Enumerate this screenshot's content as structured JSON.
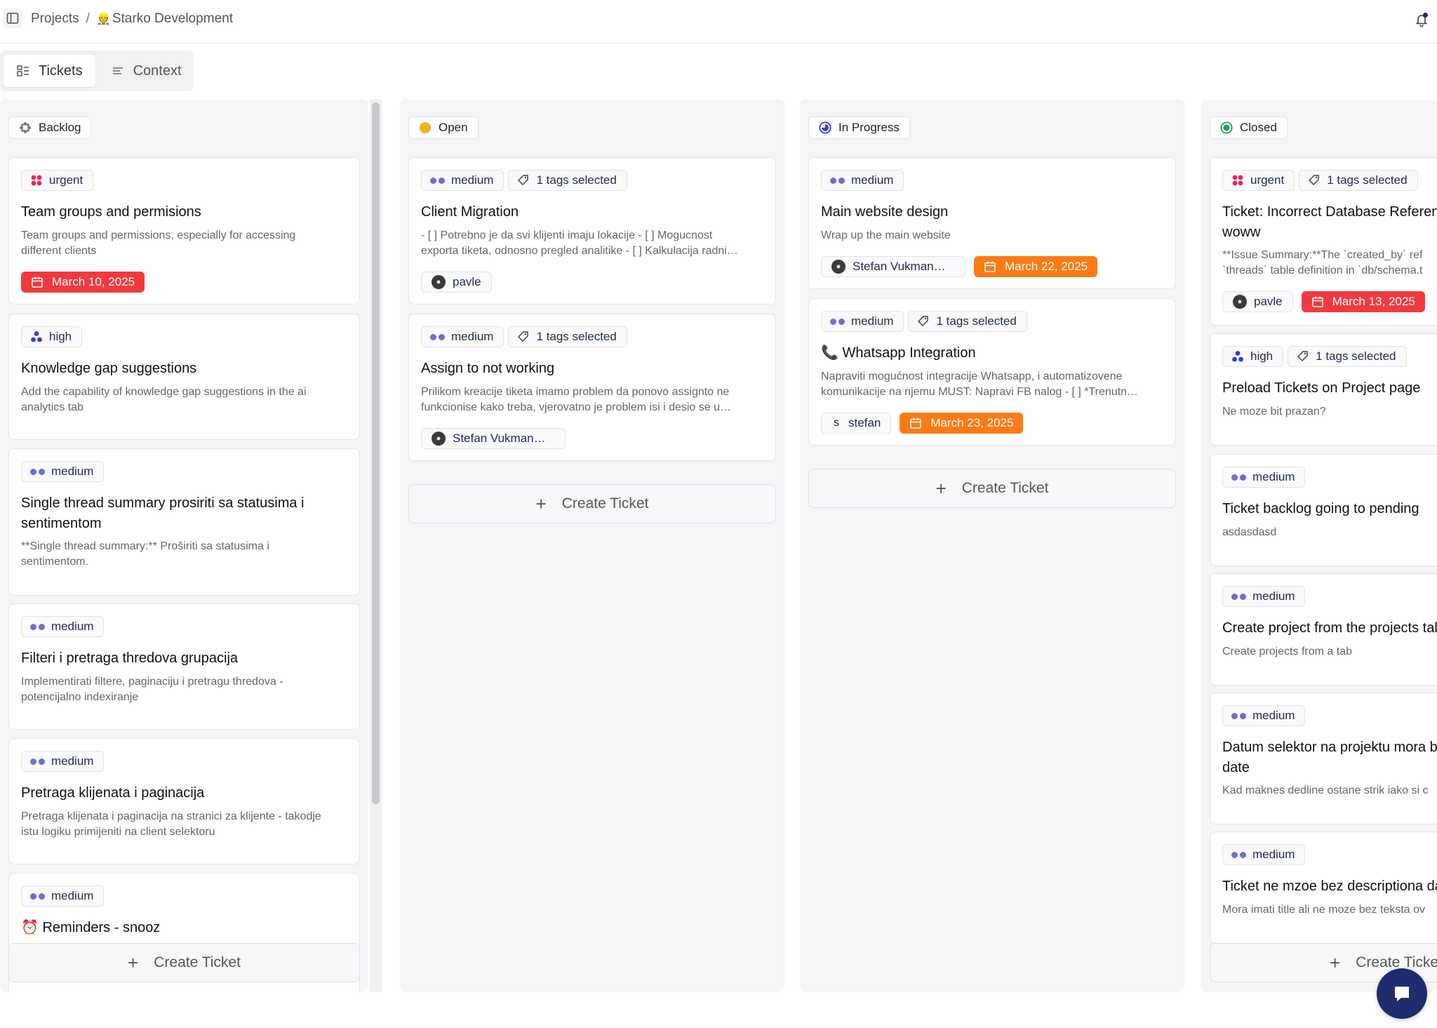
{
  "breadcrumb": {
    "root": "Projects",
    "separator": "/",
    "project_emoji": "👷",
    "project": "Starko Development"
  },
  "tabs": [
    {
      "label": "Tickets"
    },
    {
      "label": "Context"
    }
  ],
  "create_label": "Create Ticket",
  "columns": {
    "backlog": {
      "title": "Backlog",
      "cards": [
        {
          "priority": "urgent",
          "title": "Team groups and permisions",
          "desc1": "Team groups and permissions, especially for accessing",
          "desc2": "different clients",
          "date": "March 10, 2025"
        },
        {
          "priority": "high",
          "title": "Knowledge gap suggestions",
          "desc1": "Add the capability of knowledge gap suggestions in the ai",
          "desc2": "analytics tab"
        },
        {
          "priority": "medium",
          "title1": "Single thread summary prosiriti sa statusima i",
          "title2": "sentimentom",
          "desc1": "**Single thread summary:** Proširiti sa statusima i",
          "desc2": "sentimentom."
        },
        {
          "priority": "medium",
          "title": "Filteri i pretraga thredova grupacija",
          "desc1": "Implementirati filtere, paginaciju i pretragu thredova -",
          "desc2": "potencijalno indexiranje"
        },
        {
          "priority": "medium",
          "title": "Pretraga klijenata i paginacija",
          "desc1": "Pretraga klijenata i paginacija na stranici za klijente - takodje",
          "desc2": "istu logiku primijeniti na client selektoru"
        },
        {
          "priority": "medium",
          "title_emoji": "⏰",
          "title": "Reminders - snooz"
        }
      ]
    },
    "open": {
      "title": "Open",
      "cards": [
        {
          "priority": "medium",
          "tags": "1 tags selected",
          "title": "Client Migration",
          "desc1": "- [ ] Potrebno je da svi klijenti imaju lokacije - [ ] Mogucnost",
          "desc2": "exporta tiketa, odnosno pregled analitike - [ ] Kalkulacija radni…",
          "assignee": "pavle"
        },
        {
          "priority": "medium",
          "tags": "1 tags selected",
          "title": "Assign to not working",
          "desc1": "Prilikom kreacije tiketa imamo problem da ponovo assignto ne",
          "desc2": "funkcionise kako treba, vjerovatno je problem isi i desio se u…",
          "assignee": "Stefan Vukman…"
        }
      ]
    },
    "in_progress": {
      "title": "In Progress",
      "cards": [
        {
          "priority": "medium",
          "title": "Main website design",
          "desc1": "Wrap up the main website",
          "assignee": "Stefan Vukman…",
          "date": "March 22, 2025"
        },
        {
          "priority": "medium",
          "tags": "1 tags selected",
          "title_emoji": "📞",
          "title": "Whatsapp Integration",
          "desc1": "Napraviti mogućnost integracije Whatsapp, i automatizovene",
          "desc2": "komunikacije na njemu MUST: Napravi FB nalog - [ ] *Trenutn…",
          "assignee_letter": "s",
          "assignee": "stefan",
          "date": "March 23, 2025"
        }
      ]
    },
    "closed": {
      "title": "Closed",
      "cards": [
        {
          "priority": "urgent",
          "tags": "1 tags selected",
          "title1": "Ticket: Incorrect Database Referen",
          "title2": "woww",
          "desc1": "**Issue Summary:**The `created_by` ref",
          "desc2": "`threads` table definition in `db/schema.t",
          "assignee": "pavle",
          "date": "March 13, 2025"
        },
        {
          "priority": "high",
          "tags": "1 tags selected",
          "title": "Preload Tickets on Project page",
          "desc1": "Ne moze bit prazan?"
        },
        {
          "priority": "medium",
          "title": "Ticket backlog going to pending",
          "desc1": "asdasdasd"
        },
        {
          "priority": "medium",
          "title": "Create project from the projects tal",
          "desc1": "Create projects from a tab"
        },
        {
          "priority": "medium",
          "title1": "Datum selektor na projektu mora b",
          "title2": "date",
          "desc1": "Kad maknes dedline ostane strik iako si c"
        },
        {
          "priority": "medium",
          "title": "Ticket ne mzoe bez descriptiona da",
          "desc1": "Mora imati title ali ne moze bez teksta ov"
        }
      ],
      "create_label": "Create Ticke"
    }
  },
  "colors": {
    "urgent": "#e8245a",
    "high": "#2f3fd0",
    "medium": "#6b6fd0",
    "date_red": "#f03a3e",
    "date_orange": "#fb7a16",
    "open": "#f2b116",
    "in_progress": "#2f3fd0",
    "closed": "#1aa34a",
    "chat": "#1f2d6e"
  }
}
